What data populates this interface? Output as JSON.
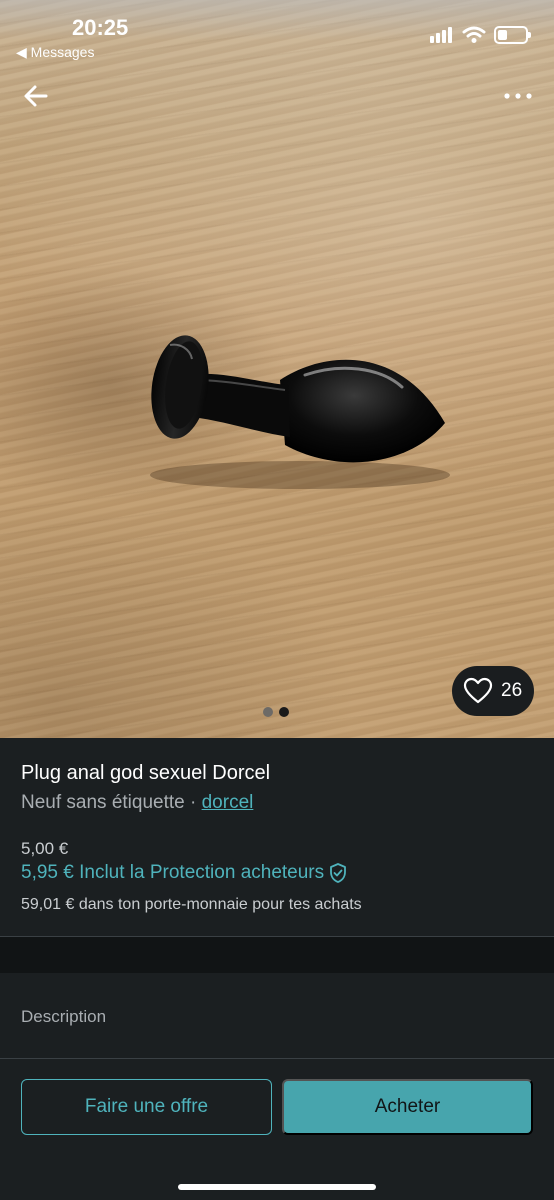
{
  "status_bar": {
    "time": "20:25",
    "back_app": "◀ Messages"
  },
  "photo": {
    "like_count": "26",
    "page_dots": 2,
    "current_page": 2
  },
  "listing": {
    "title": "Plug anal god sexuel Dorcel",
    "condition": "Neuf sans étiquette · ",
    "brand": "dorcel",
    "price": "5,00 €",
    "price_with_protection": "5,95 € Inclut la Protection acheteurs",
    "wallet_note": "59,01 € dans ton porte-monnaie pour tes achats"
  },
  "description": {
    "label": "Description"
  },
  "actions": {
    "offer_label": "Faire une offre",
    "buy_label": "Acheter"
  },
  "colors": {
    "accent": "#4fb3bc",
    "button_fill": "#47a5ad",
    "background": "#1b1f21"
  },
  "icons": {
    "nav_back": "arrow-left-icon",
    "nav_more": "more-horizontal-icon",
    "like": "heart-icon",
    "protection": "shield-check-icon"
  }
}
